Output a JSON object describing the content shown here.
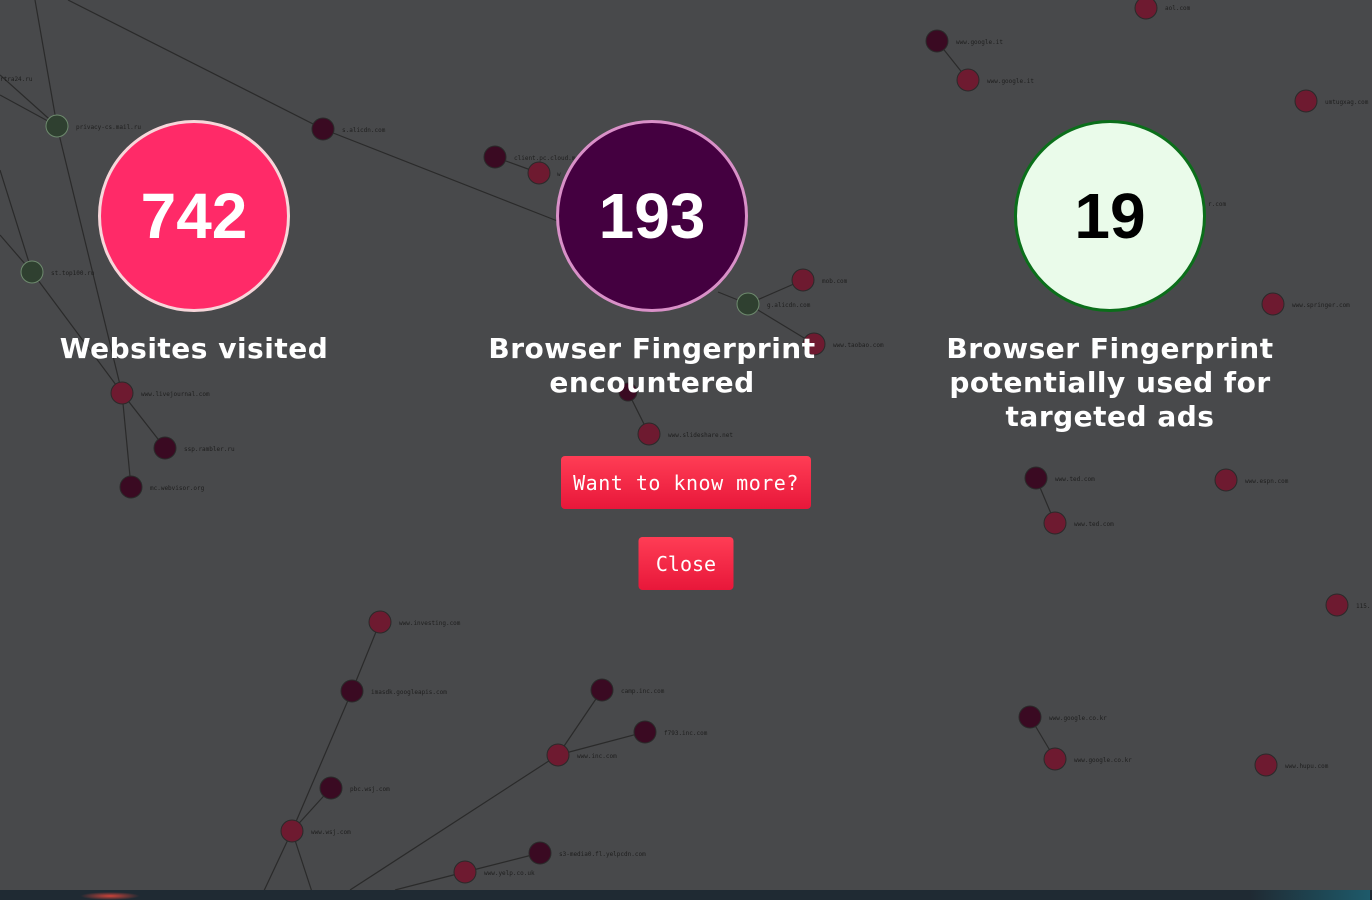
{
  "stats": [
    {
      "value": "742",
      "label": "Websites visited",
      "color": "#ff2a68"
    },
    {
      "value": "193",
      "label": "Browser Fingerprint encountered",
      "color": "#440040"
    },
    {
      "value": "19",
      "label": "Browser Fingerprint potentially used for targeted ads",
      "color": "#eafbea"
    }
  ],
  "buttons": {
    "more": "Want to know more?",
    "close": "Close"
  },
  "node_colors": {
    "fingerprint": "#3a0a22",
    "ads": "#6e1a30",
    "site": "#2f4030"
  },
  "graph_labels": [
    "aol.com",
    "www.google.it",
    "www.google.it",
    "umtugxag.com",
    "r.com",
    "www.springer.com",
    "s.alicdn.com",
    "client.pc.cloud.m",
    "w",
    "privacy-cs.mail.ru",
    "rtra24.ru",
    "st.top100.ru",
    "www.livejournal.com",
    "ssp.rambler.ru",
    "mc.webvisor.org",
    "mob.com",
    "g.alicdn.com",
    "www.taobao.com",
    "www.slideshare.net",
    "www.ted.com",
    "www.ted.com",
    "www.espn.com",
    "115.",
    "www.investing.com",
    "imasdk.googleapis.com",
    "pbc.wsj.com",
    "www.wsj.com",
    "camp.inc.com",
    "f793.inc.com",
    "www.inc.com",
    "s3-media0.fl.yelpcdn.com",
    "www.yelp.co.uk",
    "www.google.co.kr",
    "www.google.co.kr",
    "www.hupu.com"
  ]
}
